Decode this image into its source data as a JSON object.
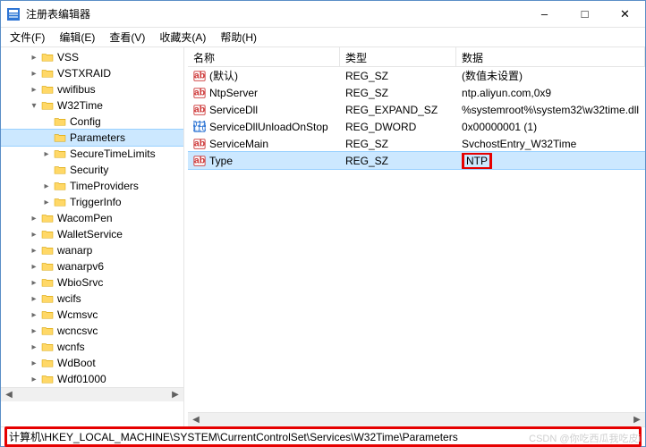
{
  "window": {
    "title": "注册表编辑器"
  },
  "menubar": {
    "file": "文件(F)",
    "edit": "编辑(E)",
    "view": "查看(V)",
    "favorites": "收藏夹(A)",
    "help": "帮助(H)"
  },
  "tree": [
    {
      "label": "VSS",
      "depth": 2,
      "twisty": ">"
    },
    {
      "label": "VSTXRAID",
      "depth": 2,
      "twisty": ">"
    },
    {
      "label": "vwifibus",
      "depth": 2,
      "twisty": ">"
    },
    {
      "label": "W32Time",
      "depth": 2,
      "twisty": "v"
    },
    {
      "label": "Config",
      "depth": 3,
      "twisty": ""
    },
    {
      "label": "Parameters",
      "depth": 3,
      "twisty": "",
      "selected": true
    },
    {
      "label": "SecureTimeLimits",
      "depth": 3,
      "twisty": ">"
    },
    {
      "label": "Security",
      "depth": 3,
      "twisty": ""
    },
    {
      "label": "TimeProviders",
      "depth": 3,
      "twisty": ">"
    },
    {
      "label": "TriggerInfo",
      "depth": 3,
      "twisty": ">"
    },
    {
      "label": "WacomPen",
      "depth": 2,
      "twisty": ">"
    },
    {
      "label": "WalletService",
      "depth": 2,
      "twisty": ">"
    },
    {
      "label": "wanarp",
      "depth": 2,
      "twisty": ">"
    },
    {
      "label": "wanarpv6",
      "depth": 2,
      "twisty": ">"
    },
    {
      "label": "WbioSrvc",
      "depth": 2,
      "twisty": ">"
    },
    {
      "label": "wcifs",
      "depth": 2,
      "twisty": ">"
    },
    {
      "label": "Wcmsvc",
      "depth": 2,
      "twisty": ">"
    },
    {
      "label": "wcncsvc",
      "depth": 2,
      "twisty": ">"
    },
    {
      "label": "wcnfs",
      "depth": 2,
      "twisty": ">"
    },
    {
      "label": "WdBoot",
      "depth": 2,
      "twisty": ">"
    },
    {
      "label": "Wdf01000",
      "depth": 2,
      "twisty": ">"
    }
  ],
  "list": {
    "headers": {
      "name": "名称",
      "type": "类型",
      "data": "数据"
    },
    "rows": [
      {
        "icon": "str",
        "name": "(默认)",
        "type": "REG_SZ",
        "data": "(数值未设置)"
      },
      {
        "icon": "str",
        "name": "NtpServer",
        "type": "REG_SZ",
        "data": "ntp.aliyun.com,0x9"
      },
      {
        "icon": "str",
        "name": "ServiceDll",
        "type": "REG_EXPAND_SZ",
        "data": "%systemroot%\\system32\\w32time.dll"
      },
      {
        "icon": "bin",
        "name": "ServiceDllUnloadOnStop",
        "type": "REG_DWORD",
        "data": "0x00000001 (1)"
      },
      {
        "icon": "str",
        "name": "ServiceMain",
        "type": "REG_SZ",
        "data": "SvchostEntry_W32Time"
      },
      {
        "icon": "str",
        "name": "Type",
        "type": "REG_SZ",
        "data": "NTP",
        "selected": true,
        "highlightData": true
      }
    ]
  },
  "statusbar": {
    "path": "计算机\\HKEY_LOCAL_MACHINE\\SYSTEM\\CurrentControlSet\\Services\\W32Time\\Parameters"
  },
  "watermark": "CSDN @你吃西瓜我吃皮i"
}
